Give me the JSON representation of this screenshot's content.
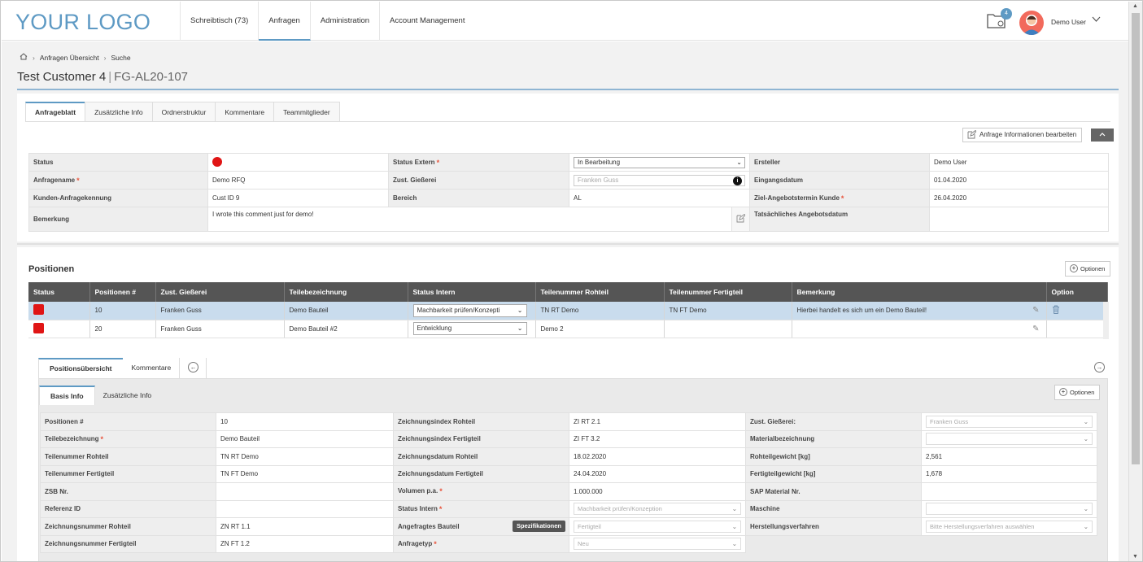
{
  "header": {
    "logo": "YOUR LOGO",
    "nav": [
      {
        "label": "Schreibtisch  (73)",
        "active": false
      },
      {
        "label": "Anfragen",
        "active": true
      },
      {
        "label": "Administration",
        "active": false
      },
      {
        "label": "Account Management",
        "active": false
      }
    ],
    "notification_count": "4",
    "user_name": "Demo User"
  },
  "breadcrumb": [
    "Anfragen Übersicht",
    "Suche"
  ],
  "title": {
    "customer": "Test Customer 4",
    "code": "FG-AL20-107"
  },
  "tabs": [
    "Anfrageblatt",
    "Zusätzliche Info",
    "Ordnerstruktur",
    "Kommentare",
    "Teammitglieder"
  ],
  "edit_button": "Anfrage Informationen bearbeiten",
  "info": {
    "status_label": "Status",
    "status_extern_label": "Status Extern",
    "status_extern_value": "In Bearbeitung",
    "ersteller_label": "Ersteller",
    "ersteller_value": "Demo User",
    "anfragename_label": "Anfragename",
    "anfragename_value": "Demo RFQ",
    "giesserei_label": "Zust. Gießerei",
    "giesserei_placeholder": "Franken Guss",
    "eingangsdatum_label": "Eingangsdatum",
    "eingangsdatum_value": "01.04.2020",
    "kennung_label": "Kunden-Anfragekennung",
    "kennung_value": "Cust ID 9",
    "bereich_label": "Bereich",
    "bereich_value": "AL",
    "ziel_label": "Ziel-Angebotstermin Kunde",
    "ziel_value": "26.04.2020",
    "bemerkung_label": "Bemerkung",
    "bemerkung_value": "I wrote this comment just for demo!",
    "tats_label": "Tatsächliches Angebotsdatum"
  },
  "positions": {
    "title": "Positionen",
    "options_label": "Optionen",
    "columns": [
      "Status",
      "Positionen #",
      "Zust. Gießerei",
      "Teilebezeichnung",
      "Status Intern",
      "Teilenummer Rohteil",
      "Teilenummer Fertigteil",
      "Bemerkung",
      "Option"
    ],
    "rows": [
      {
        "pos": "10",
        "giesserei": "Franken Guss",
        "teil": "Demo Bauteil",
        "status_intern": "Machbarkeit prüfen/Konzepti",
        "roh": "TN RT Demo",
        "fertig": "TN FT Demo",
        "bemerkung": "Hierbei handelt es sich um ein Demo Bauteil!"
      },
      {
        "pos": "20",
        "giesserei": "Franken Guss",
        "teil": "Demo Bauteil #2",
        "status_intern": "Entwicklung",
        "roh": "Demo 2",
        "fertig": "",
        "bemerkung": ""
      }
    ]
  },
  "subtabs": [
    "Positionsübersicht",
    "Kommentare"
  ],
  "innertabs": [
    "Basis Info",
    "Zusätzliche Info"
  ],
  "basis": {
    "options_label": "Optionen",
    "rows": [
      [
        "Positionen #",
        "10",
        "Zeichnungsindex Rohteil",
        "ZI RT 2.1",
        "Zust. Gießerei:",
        "Franken Guss"
      ],
      [
        "Teilebezeichnung",
        "Demo Bauteil",
        "Zeichnungsindex Fertigteil",
        "ZI FT 3.2",
        "Materialbezeichnung",
        ""
      ],
      [
        "Teilenummer Rohteil",
        "TN RT Demo",
        "Zeichnungsdatum Rohteil",
        "18.02.2020",
        "Rohteilgewicht [kg]",
        "2,561"
      ],
      [
        "Teilenummer Fertigteil",
        "TN FT Demo",
        "Zeichnungsdatum Fertigteil",
        "24.04.2020",
        "Fertigteilgewicht [kg]",
        "1,678"
      ],
      [
        "ZSB Nr.",
        "",
        "Volumen p.a.",
        "1.000.000",
        "SAP Material Nr.",
        ""
      ],
      [
        "Referenz ID",
        "",
        "Status Intern",
        "Machbarkeit prüfen/Konzeption",
        "Maschine",
        ""
      ],
      [
        "Zeichnungsnummer Rohteil",
        "ZN RT 1.1",
        "Angefragtes Bauteil",
        "Fertigteil",
        "Herstellungsverfahren",
        "Bitte Herstellungsverfahren auswählen"
      ],
      [
        "Zeichnungsnummer Fertigteil",
        "ZN FT 1.2",
        "Anfragetyp",
        "Neu",
        "",
        ""
      ]
    ],
    "spec_button": "Spezifikationen"
  }
}
